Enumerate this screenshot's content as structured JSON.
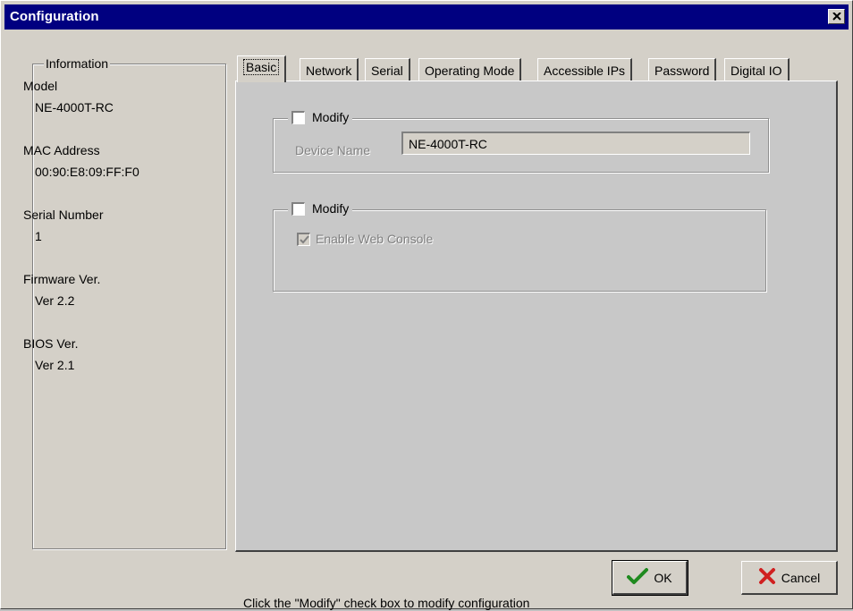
{
  "window": {
    "title": "Configuration"
  },
  "info": {
    "group_title": "Information",
    "fields": [
      {
        "label": "Model",
        "value": "NE-4000T-RC"
      },
      {
        "label": "MAC Address",
        "value": "00:90:E8:09:FF:F0"
      },
      {
        "label": "Serial Number",
        "value": "1"
      },
      {
        "label": "Firmware Ver.",
        "value": "Ver 2.2"
      },
      {
        "label": "BIOS Ver.",
        "value": "Ver 2.1"
      }
    ]
  },
  "tabs": [
    {
      "label": "Basic",
      "active": true
    },
    {
      "label": "Network"
    },
    {
      "label": "Serial"
    },
    {
      "label": "Operating Mode"
    },
    {
      "label": "Accessible IPs"
    },
    {
      "label": "Password"
    },
    {
      "label": "Digital IO"
    }
  ],
  "basic": {
    "group1": {
      "modify_label": "Modify",
      "modify_checked": false,
      "device_name_label": "Device Name",
      "device_name_value": "NE-4000T-RC"
    },
    "group2": {
      "modify_label": "Modify",
      "modify_checked": false,
      "web_console_label": "Enable Web Console",
      "web_console_checked": true
    }
  },
  "footer": {
    "hint": "Click the \"Modify\" check box to modify configuration",
    "ok_label": "OK",
    "cancel_label": "Cancel"
  }
}
